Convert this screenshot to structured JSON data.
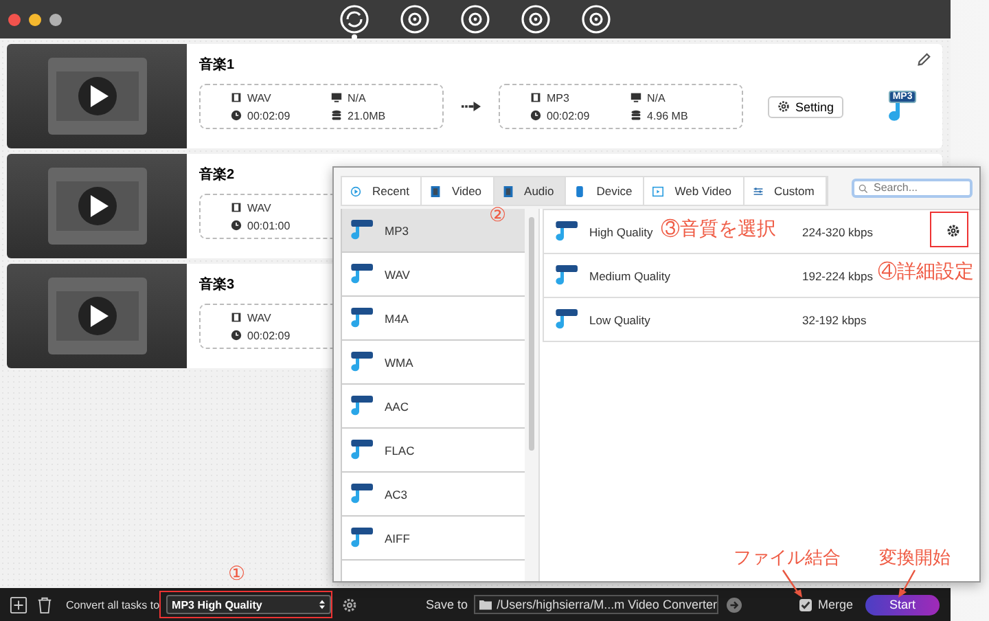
{
  "toolbar": {
    "tabs": [
      {
        "selected": true
      },
      {
        "selected": false
      },
      {
        "selected": false
      },
      {
        "selected": false
      },
      {
        "selected": false
      }
    ]
  },
  "tasks": [
    {
      "title": "音楽1",
      "source": [
        {
          "kind": "format",
          "text": "WAV"
        },
        {
          "kind": "duration",
          "text": "00:02:09"
        },
        {
          "kind": "resolution",
          "text": "N/A"
        },
        {
          "kind": "size",
          "text": "21.0MB"
        }
      ],
      "target": [
        {
          "kind": "format",
          "text": "MP3"
        },
        {
          "kind": "duration",
          "text": "00:02:09"
        },
        {
          "kind": "resolution",
          "text": "N/A"
        },
        {
          "kind": "size",
          "text": "4.96 MB"
        }
      ],
      "setting_button": "Setting",
      "badge": "MP3"
    },
    {
      "title": "音楽2",
      "source": [
        {
          "kind": "format",
          "text": "WAV"
        },
        {
          "kind": "duration",
          "text": "00:01:00"
        }
      ]
    },
    {
      "title": "音楽3",
      "source": [
        {
          "kind": "format",
          "text": "WAV"
        },
        {
          "kind": "duration",
          "text": "00:02:09"
        }
      ]
    }
  ],
  "format_popup": {
    "tabs": [
      {
        "label": "Recent",
        "kind": "recent",
        "selected": false
      },
      {
        "label": "Video",
        "kind": "video",
        "selected": false
      },
      {
        "label": "Audio",
        "kind": "audio",
        "selected": true
      },
      {
        "label": "Device",
        "kind": "device",
        "selected": false
      },
      {
        "label": "Web Video",
        "kind": "web",
        "selected": false
      },
      {
        "label": "Custom",
        "kind": "custom",
        "selected": false
      }
    ],
    "search": {
      "placeholder": "Search..."
    },
    "formats": [
      {
        "label": "MP3",
        "selected": true
      },
      {
        "label": "WAV",
        "selected": false
      },
      {
        "label": "M4A",
        "selected": false
      },
      {
        "label": "WMA",
        "selected": false
      },
      {
        "label": "AAC",
        "selected": false
      },
      {
        "label": "FLAC",
        "selected": false
      },
      {
        "label": "AC3",
        "selected": false
      },
      {
        "label": "AIFF",
        "selected": false
      }
    ],
    "presets": [
      {
        "name": "High Quality",
        "bitrate": "224-320 kbps",
        "settings": true
      },
      {
        "name": "Medium Quality",
        "bitrate": "192-224 kbps",
        "settings": false
      },
      {
        "name": "Low Quality",
        "bitrate": "32-192 kbps",
        "settings": false
      }
    ]
  },
  "bottom_bar": {
    "convert_label": "Convert all tasks to",
    "convert_value": "MP3 High Quality",
    "save_label": "Save to",
    "save_path": "/Users/highsierra/M...m Video Converter",
    "merge": {
      "label": "Merge",
      "checked": true
    },
    "start_button": "Start"
  },
  "annotations": [
    {
      "kind": "step",
      "text": "①"
    },
    {
      "kind": "step",
      "text": "②"
    },
    {
      "kind": "step",
      "text": "③音質を選択"
    },
    {
      "kind": "step",
      "text": "④詳細設定"
    },
    {
      "kind": "callout",
      "text": "ファイル結合"
    },
    {
      "kind": "callout",
      "text": "変換開始"
    }
  ]
}
